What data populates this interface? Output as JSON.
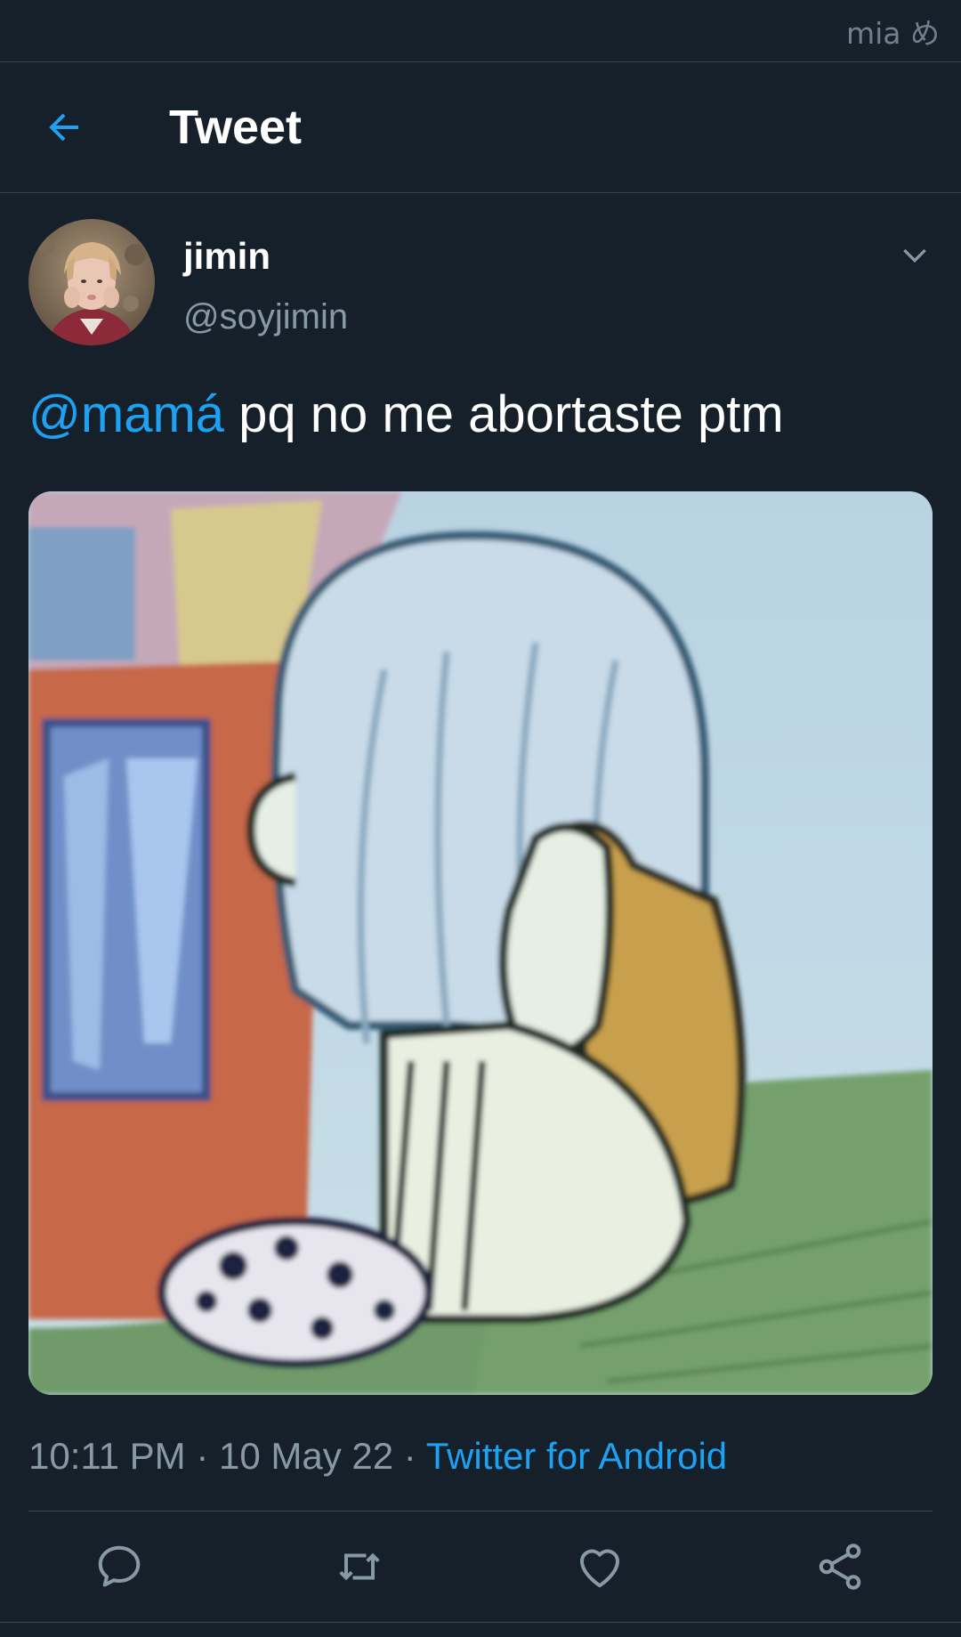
{
  "watermark": "mia め",
  "header": {
    "title": "Tweet",
    "back_icon": "arrow-left-icon"
  },
  "tweet": {
    "author": {
      "name": "jimin",
      "handle": "@soyjimin"
    },
    "mention": "@mamá",
    "text": " pq no me abortaste ptm",
    "time": "10:11 PM",
    "separator": " · ",
    "date": "10 May 22",
    "source": "Twitter for Android"
  },
  "actions": {
    "reply_icon": "speech-bubble-icon",
    "retweet_icon": "retweet-icon",
    "like_icon": "heart-icon",
    "share_icon": "share-icon"
  },
  "colors": {
    "background": "#15202b",
    "accent": "#1da1f2",
    "secondary_text": "#8899a6",
    "divider": "#38444d"
  }
}
